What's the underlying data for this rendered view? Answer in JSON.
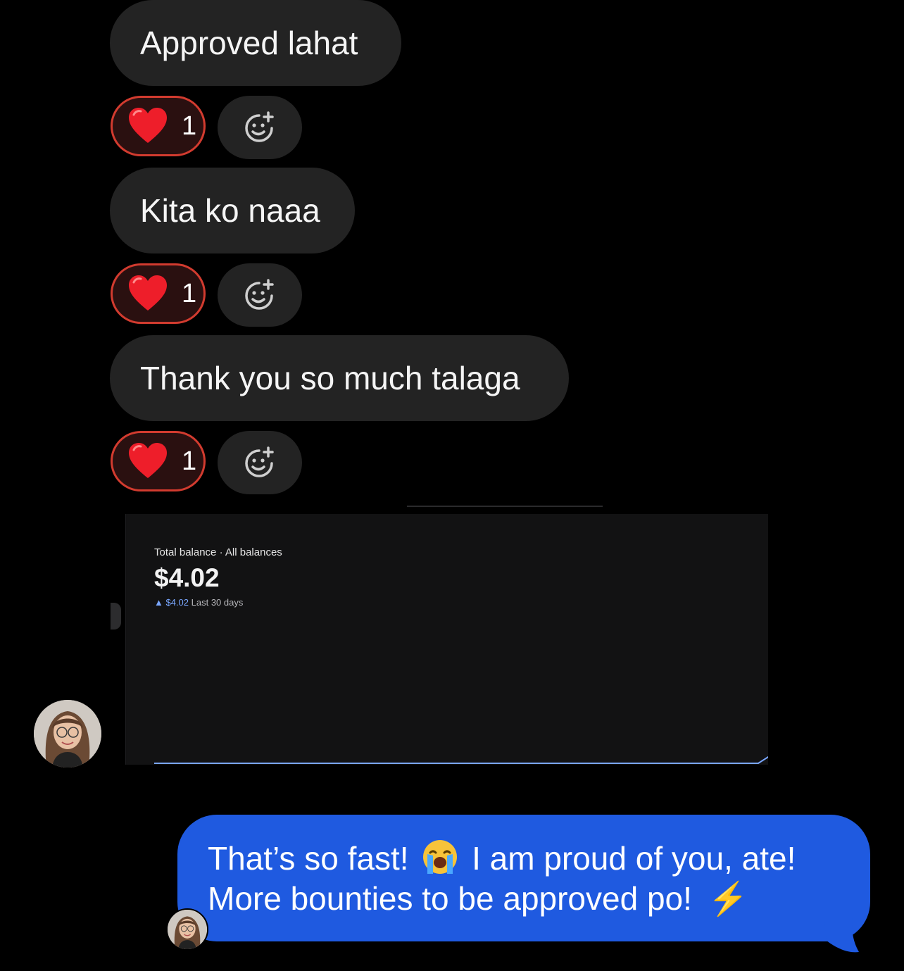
{
  "messages_in": [
    {
      "text": "Approved lahat",
      "reaction": {
        "emoji": "heart",
        "count": "1"
      }
    },
    {
      "text": "Kita ko naaa",
      "reaction": {
        "emoji": "heart",
        "count": "1"
      }
    },
    {
      "text": "Thank you so much talaga",
      "reaction": {
        "emoji": "heart",
        "count": "1"
      }
    }
  ],
  "shared_screenshot": {
    "label": "Total balance · All balances",
    "balance": "$4.02",
    "change": "▲ $4.02",
    "period": "Last 30 days"
  },
  "message_out": {
    "line1_a": "That’s so fast!",
    "line1_emoji": "loudly-crying-face",
    "line1_b": "I am proud of you, ate!",
    "line2": "More bounties to be approved po!",
    "line2_emoji": "⚡"
  },
  "colors": {
    "background": "#000000",
    "incoming_bubble": "#232323",
    "outgoing_bubble": "#1f5ae0",
    "reaction_border": "#d23b2f",
    "chart_line": "#7aa7ff"
  }
}
